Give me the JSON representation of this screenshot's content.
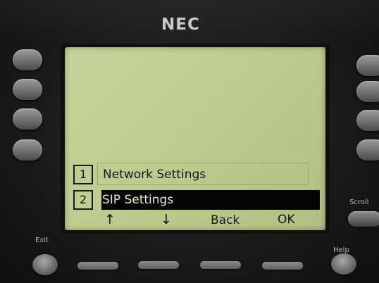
{
  "device": {
    "brand": "NEC"
  },
  "screen": {
    "menu": [
      {
        "number": "1",
        "label": "Network Settings"
      },
      {
        "number": "2",
        "label": "SIP Settings"
      }
    ],
    "soft_keys": {
      "up": "↑",
      "down": "↓",
      "back": "Back",
      "ok": "OK"
    }
  },
  "buttons": {
    "scroll": "Scroll",
    "exit": "Exit",
    "help": "Help"
  },
  "colors": {
    "lcd_background": "#bccc8f",
    "selection": "#050505",
    "housing": "#1b1b1b"
  }
}
